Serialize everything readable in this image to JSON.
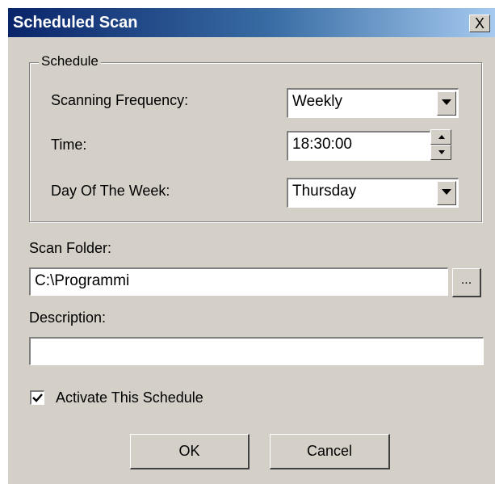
{
  "window": {
    "title": "Scheduled Scan",
    "close_label": "X"
  },
  "schedule_group": {
    "title": "Schedule",
    "frequency_label": "Scanning Frequency:",
    "frequency_value": "Weekly",
    "time_label": "Time:",
    "time_value": "18:30:00",
    "day_label": "Day Of The Week:",
    "day_value": "Thursday"
  },
  "scan_folder": {
    "label": "Scan Folder:",
    "value": "C:\\Programmi",
    "browse_label": "..."
  },
  "description": {
    "label": "Description:",
    "value": ""
  },
  "activate": {
    "label": "Activate This Schedule",
    "checked": true
  },
  "buttons": {
    "ok": "OK",
    "cancel": "Cancel"
  },
  "icons": {
    "dropdown": "chevron-down-icon",
    "spin_up": "spin-up-icon",
    "spin_down": "spin-down-icon",
    "check": "check-icon"
  }
}
